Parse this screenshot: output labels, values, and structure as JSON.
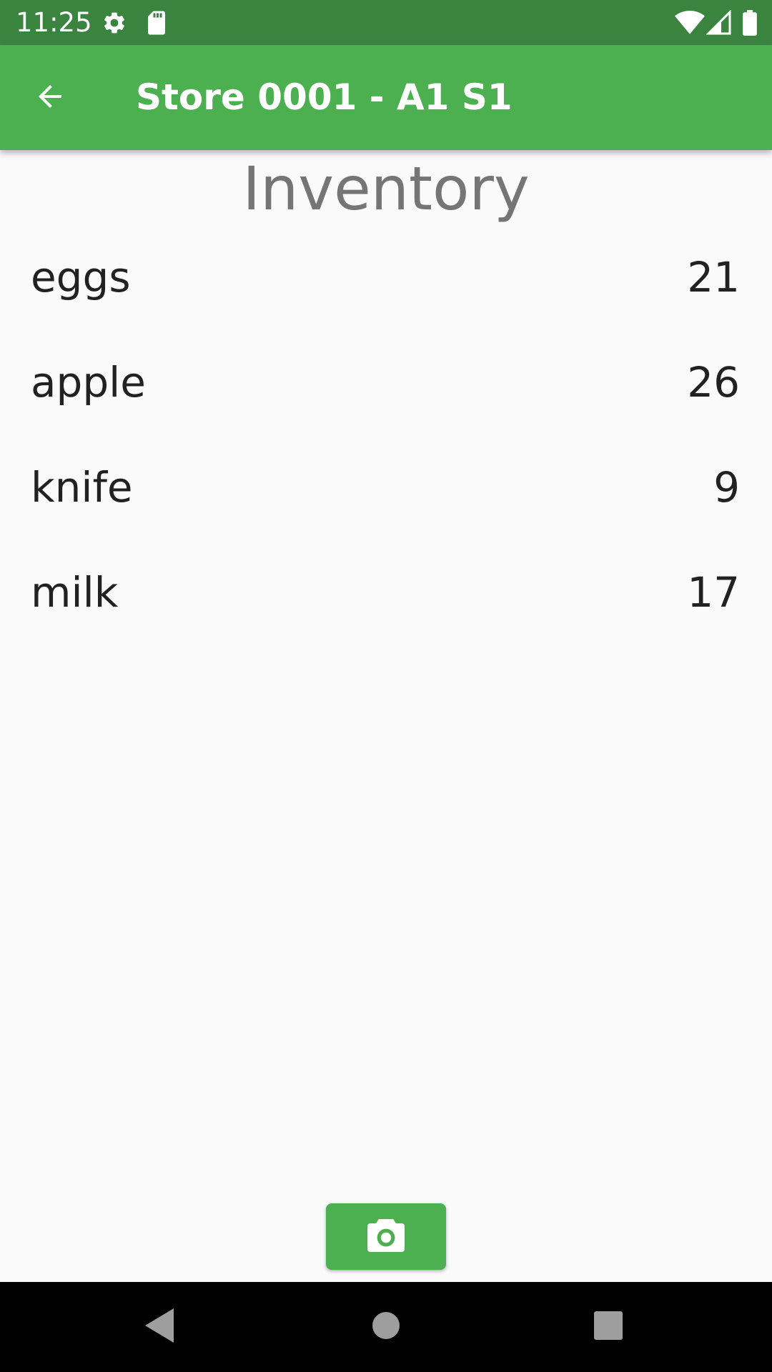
{
  "status_bar": {
    "time": "11:25",
    "icons": [
      "settings-icon",
      "sd-card-icon",
      "wifi-icon",
      "signal-icon",
      "battery-icon"
    ]
  },
  "app_bar": {
    "back_icon": "arrow-back-icon",
    "title": "Store 0001 - A1 S1"
  },
  "main": {
    "heading": "Inventory",
    "items": [
      {
        "name": "eggs",
        "quantity": "21"
      },
      {
        "name": "apple",
        "quantity": "26"
      },
      {
        "name": "knife",
        "quantity": "9"
      },
      {
        "name": "milk",
        "quantity": "17"
      }
    ]
  },
  "actions": {
    "camera_icon": "camera-icon"
  },
  "nav_bar": {
    "icons": [
      "back-triangle-icon",
      "home-circle-icon",
      "recents-square-icon"
    ]
  },
  "colors": {
    "status_bar": "#3b8440",
    "app_bar": "#4caf50",
    "accent": "#4caf50",
    "background": "#fafafa",
    "heading_text": "#757575",
    "body_text": "#212121"
  }
}
